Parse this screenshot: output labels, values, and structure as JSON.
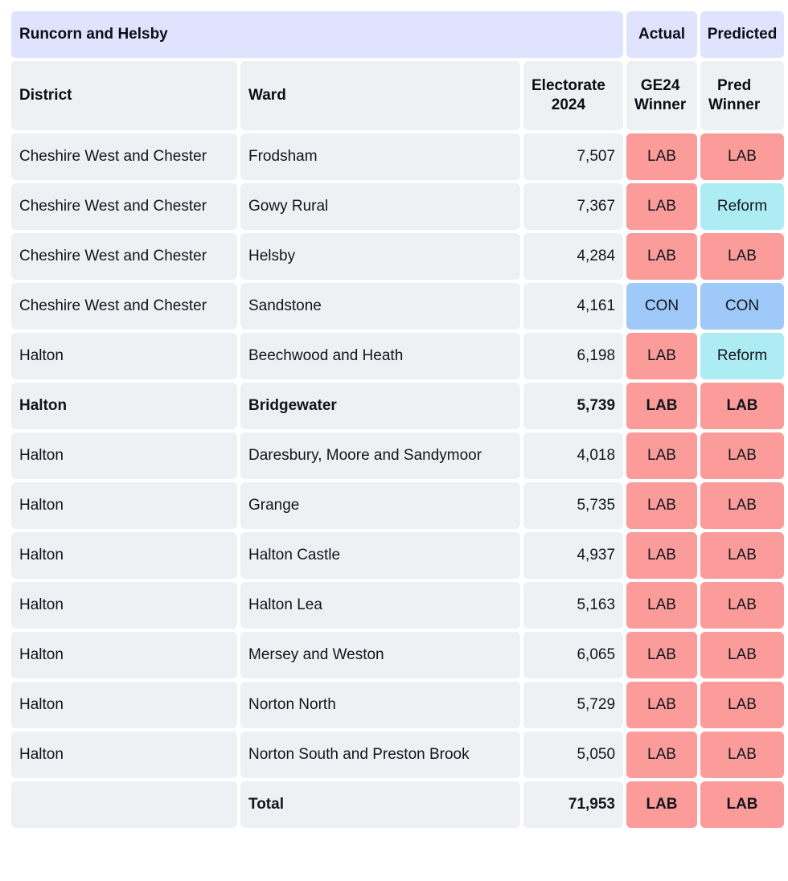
{
  "table": {
    "group_header": {
      "constituency": "Runcorn and Helsby",
      "actual": "Actual",
      "predicted": "Predicted"
    },
    "columns": {
      "district": "District",
      "ward": "Ward",
      "electorate_line1": "Electorate",
      "electorate_line2": "2024",
      "ge24_line1": "GE24",
      "ge24_line2": "Winner",
      "pred_line1": "Pred",
      "pred_line2": "Winner"
    },
    "rows": [
      {
        "district": "Cheshire West and Chester",
        "ward": "Frodsham",
        "electorate": "7,507",
        "ge24": "LAB",
        "pred": "LAB",
        "bold": false
      },
      {
        "district": "Cheshire West and Chester",
        "ward": "Gowy Rural",
        "electorate": "7,367",
        "ge24": "LAB",
        "pred": "Reform",
        "bold": false
      },
      {
        "district": "Cheshire West and Chester",
        "ward": "Helsby",
        "electorate": "4,284",
        "ge24": "LAB",
        "pred": "LAB",
        "bold": false
      },
      {
        "district": "Cheshire West and Chester",
        "ward": "Sandstone",
        "electorate": "4,161",
        "ge24": "CON",
        "pred": "CON",
        "bold": false
      },
      {
        "district": "Halton",
        "ward": "Beechwood and Heath",
        "electorate": "6,198",
        "ge24": "LAB",
        "pred": "Reform",
        "bold": false
      },
      {
        "district": "Halton",
        "ward": "Bridgewater",
        "electorate": "5,739",
        "ge24": "LAB",
        "pred": "LAB",
        "bold": true
      },
      {
        "district": "Halton",
        "ward": "Daresbury, Moore and Sandymoor",
        "electorate": "4,018",
        "ge24": "LAB",
        "pred": "LAB",
        "bold": false
      },
      {
        "district": "Halton",
        "ward": "Grange",
        "electorate": "5,735",
        "ge24": "LAB",
        "pred": "LAB",
        "bold": false
      },
      {
        "district": "Halton",
        "ward": "Halton Castle",
        "electorate": "4,937",
        "ge24": "LAB",
        "pred": "LAB",
        "bold": false
      },
      {
        "district": "Halton",
        "ward": "Halton Lea",
        "electorate": "5,163",
        "ge24": "LAB",
        "pred": "LAB",
        "bold": false
      },
      {
        "district": "Halton",
        "ward": "Mersey and Weston",
        "electorate": "6,065",
        "ge24": "LAB",
        "pred": "LAB",
        "bold": false
      },
      {
        "district": "Halton",
        "ward": "Norton North",
        "electorate": "5,729",
        "ge24": "LAB",
        "pred": "LAB",
        "bold": false
      },
      {
        "district": "Halton",
        "ward": "Norton South and Preston Brook",
        "electorate": "5,050",
        "ge24": "LAB",
        "pred": "LAB",
        "bold": false
      }
    ],
    "total_row": {
      "district": "",
      "ward": "Total",
      "electorate": "71,953",
      "ge24": "LAB",
      "pred": "LAB"
    },
    "party_colors": {
      "LAB": "#fb9c9b",
      "CON": "#9fc9f8",
      "Reform": "#aeecf3"
    },
    "theme": {
      "group_header_bg": "#dfe3fd",
      "cell_bg": "#eef0f4",
      "page_bg": "#ffffff",
      "text": "#11161c"
    }
  }
}
